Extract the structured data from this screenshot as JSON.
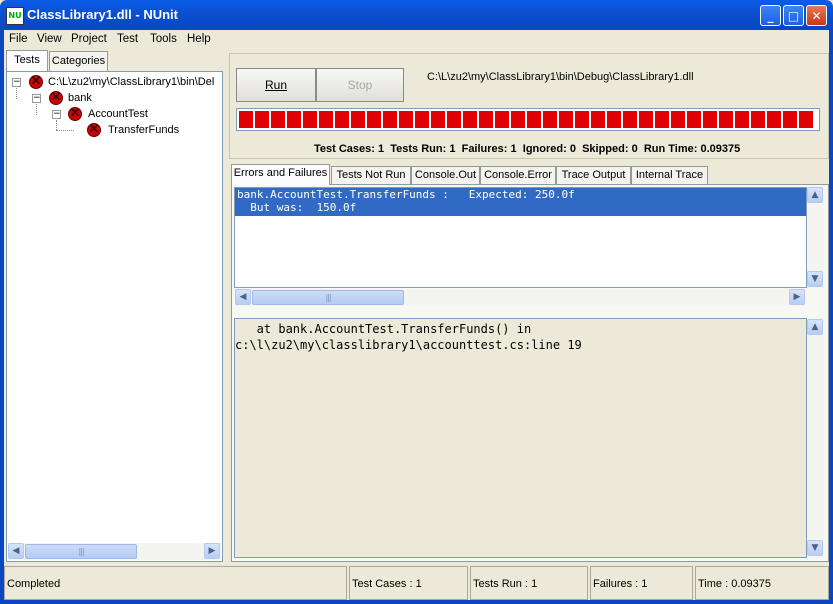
{
  "window": {
    "title": "ClassLibrary1.dll - NUnit",
    "icon_label": "NU",
    "controls": {
      "minimize": "_",
      "maximize": "□",
      "close": "✕"
    }
  },
  "menu": [
    "File",
    "View",
    "Project",
    "Test",
    "Tools",
    "Help"
  ],
  "left_tabs": [
    "Tests",
    "Categories"
  ],
  "tree": {
    "root": "C:\\L\\zu2\\my\\ClassLibrary1\\bin\\Del",
    "namespace": "bank",
    "fixture": "AccountTest",
    "test": "TransferFunds",
    "expander": "−"
  },
  "toolbar": {
    "run_label": "Run",
    "stop_label": "Stop",
    "assembly_path": "C:\\L\\zu2\\my\\ClassLibrary1\\bin\\Debug\\ClassLibrary1.dll"
  },
  "progress": {
    "fraction": 1.0,
    "color": "#e00000"
  },
  "summary": {
    "test_cases_label": "Test Cases:",
    "test_cases": "1",
    "tests_run_label": "Tests Run:",
    "tests_run": "1",
    "failures_label": "Failures:",
    "failures": "1",
    "ignored_label": "Ignored:",
    "ignored": "0",
    "skipped_label": "Skipped:",
    "skipped": "0",
    "run_time_label": "Run Time:",
    "run_time": "0.09375"
  },
  "result_tabs": [
    "Errors and Failures",
    "Tests Not Run",
    "Console.Out",
    "Console.Error",
    "Trace Output",
    "Internal Trace"
  ],
  "errors": [
    {
      "line1": "bank.AccountTest.TransferFunds :   Expected: 250.0f",
      "line2": "  But was:  150.0f"
    }
  ],
  "stack_trace": [
    "   at bank.AccountTest.TransferFunds() in",
    "c:\\l\\zu2\\my\\classlibrary1\\accounttest.cs:line 19"
  ],
  "status": {
    "state": "Completed",
    "test_cases": "Test Cases : 1",
    "tests_run": "Tests Run : 1",
    "failures": "Failures : 1",
    "time": "Time : 0.09375"
  },
  "scroll": {
    "left": "◀",
    "right": "▶",
    "up": "▲",
    "down": "▼",
    "grip": "|||"
  }
}
